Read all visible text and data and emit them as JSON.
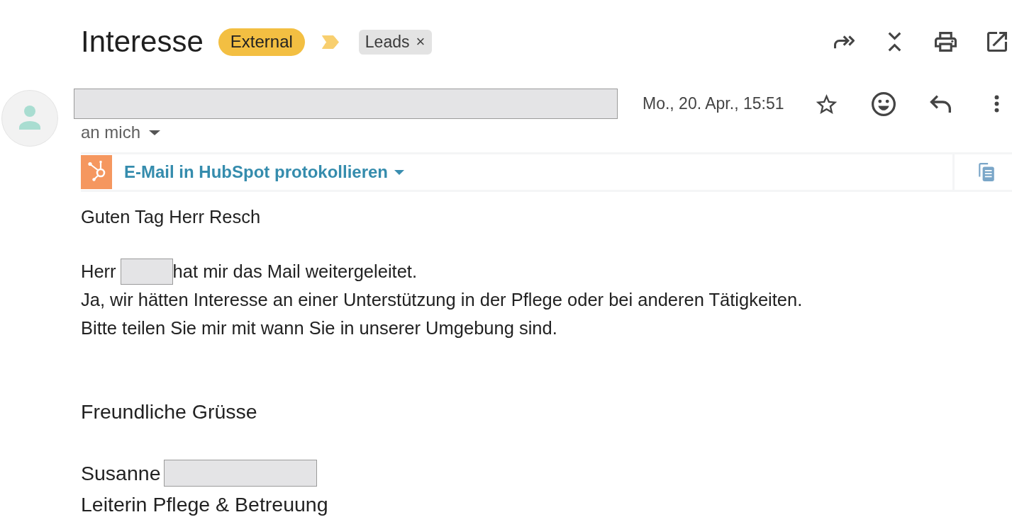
{
  "subject": {
    "text": "Interesse",
    "tags": [
      {
        "kind": "label",
        "text": "External",
        "color": "#f3bf42"
      },
      {
        "kind": "importance",
        "important": true
      },
      {
        "kind": "label",
        "text": "Leads",
        "color": "#e3e3e3",
        "remove": "×"
      }
    ]
  },
  "message": {
    "sender": {
      "kind": "redacted"
    },
    "date": "Mo., 20. Apr., 15:51",
    "starred": false,
    "recipient": "an mich"
  },
  "hubspot_bar": {
    "text": "E-Mail in HubSpot protokollieren"
  },
  "body": [
    {
      "kind": "greeting",
      "lines": [
        [
          {
            "kind": "text",
            "text": "Guten Tag Herr Resch"
          }
        ]
      ]
    },
    {
      "kind": "message",
      "lines": [
        [
          {
            "kind": "text",
            "text": "Herr"
          },
          {
            "kind": "redacted"
          },
          {
            "kind": "text",
            "text": "hat mir das Mail weitergeleitet."
          }
        ],
        [
          {
            "kind": "text",
            "text": "Ja, wir hätten Interesse an einer Unterstützung in der Pflege oder bei anderen Tätigkeiten."
          }
        ],
        [
          {
            "kind": "text",
            "text": "Bitte teilen Sie mir mit wann Sie in unserer Umgebung sind."
          }
        ]
      ]
    },
    {
      "kind": "closing",
      "lines": [
        [
          {
            "kind": "text",
            "text": "Freundliche Grüsse"
          }
        ]
      ]
    },
    {
      "kind": "signature",
      "lines": [
        [
          {
            "kind": "text",
            "text": "Susanne"
          },
          {
            "kind": "redacted"
          }
        ],
        [
          {
            "kind": "text",
            "text": "Leiterin Pflege & Betreuung"
          }
        ]
      ]
    }
  ]
}
